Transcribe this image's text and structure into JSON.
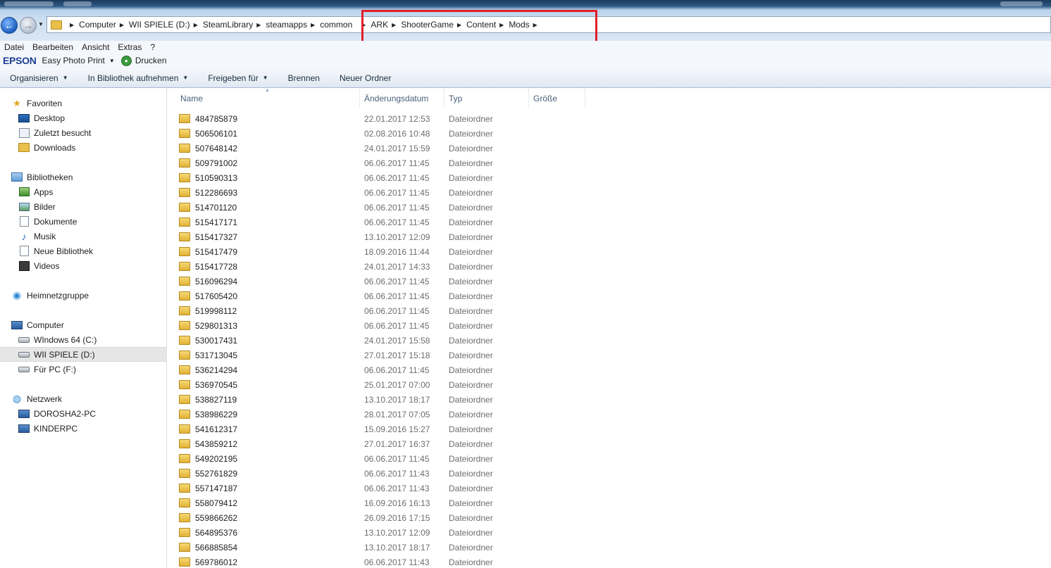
{
  "breadcrumbs": [
    "Computer",
    "WII SPIELE (D:)",
    "SteamLibrary",
    "steamapps",
    "common",
    "ARK",
    "ShooterGame",
    "Content",
    "Mods"
  ],
  "menu": [
    "Datei",
    "Bearbeiten",
    "Ansicht",
    "Extras",
    "?"
  ],
  "plugin": {
    "logo": "EPSON",
    "easy_photo": "Easy Photo Print",
    "print": "Drucken"
  },
  "toolbar": {
    "organize": "Organisieren",
    "add_library": "In Bibliothek aufnehmen",
    "share": "Freigeben für",
    "burn": "Brennen",
    "new_folder": "Neuer Ordner"
  },
  "nav": {
    "favorites": "Favoriten",
    "desktop": "Desktop",
    "recent": "Zuletzt besucht",
    "downloads": "Downloads",
    "libraries": "Bibliotheken",
    "apps": "Apps",
    "pictures": "Bilder",
    "documents": "Dokumente",
    "music": "Musik",
    "new_library": "Neue Bibliothek",
    "videos": "Videos",
    "homegroup": "Heimnetzgruppe",
    "computer": "Computer",
    "drive_c": "WIndows 64 (C:)",
    "drive_d": "WII SPIELE (D:)",
    "drive_f": "Für PC (F:)",
    "network": "Netzwerk",
    "net_pc1": "DOROSHA2-PC",
    "net_pc2": "KINDERPC"
  },
  "columns": {
    "name": "Name",
    "date": "Änderungsdatum",
    "type": "Typ",
    "size": "Größe"
  },
  "files": [
    {
      "name": "484785879",
      "date": "22.01.2017 12:53",
      "type": "Dateiordner"
    },
    {
      "name": "506506101",
      "date": "02.08.2016 10:48",
      "type": "Dateiordner"
    },
    {
      "name": "507648142",
      "date": "24.01.2017 15:59",
      "type": "Dateiordner"
    },
    {
      "name": "509791002",
      "date": "06.06.2017 11:45",
      "type": "Dateiordner"
    },
    {
      "name": "510590313",
      "date": "06.06.2017 11:45",
      "type": "Dateiordner"
    },
    {
      "name": "512286693",
      "date": "06.06.2017 11:45",
      "type": "Dateiordner"
    },
    {
      "name": "514701120",
      "date": "06.06.2017 11:45",
      "type": "Dateiordner"
    },
    {
      "name": "515417171",
      "date": "06.06.2017 11:45",
      "type": "Dateiordner"
    },
    {
      "name": "515417327",
      "date": "13.10.2017 12:09",
      "type": "Dateiordner"
    },
    {
      "name": "515417479",
      "date": "18.09.2016 11:44",
      "type": "Dateiordner"
    },
    {
      "name": "515417728",
      "date": "24.01.2017 14:33",
      "type": "Dateiordner"
    },
    {
      "name": "516096294",
      "date": "06.06.2017 11:45",
      "type": "Dateiordner"
    },
    {
      "name": "517605420",
      "date": "06.06.2017 11:45",
      "type": "Dateiordner"
    },
    {
      "name": "519998112",
      "date": "06.06.2017 11:45",
      "type": "Dateiordner"
    },
    {
      "name": "529801313",
      "date": "06.06.2017 11:45",
      "type": "Dateiordner"
    },
    {
      "name": "530017431",
      "date": "24.01.2017 15:58",
      "type": "Dateiordner"
    },
    {
      "name": "531713045",
      "date": "27.01.2017 15:18",
      "type": "Dateiordner"
    },
    {
      "name": "536214294",
      "date": "06.06.2017 11:45",
      "type": "Dateiordner"
    },
    {
      "name": "536970545",
      "date": "25.01.2017 07:00",
      "type": "Dateiordner"
    },
    {
      "name": "538827119",
      "date": "13.10.2017 18:17",
      "type": "Dateiordner"
    },
    {
      "name": "538986229",
      "date": "28.01.2017 07:05",
      "type": "Dateiordner"
    },
    {
      "name": "541612317",
      "date": "15.09.2016 15:27",
      "type": "Dateiordner"
    },
    {
      "name": "543859212",
      "date": "27.01.2017 16:37",
      "type": "Dateiordner"
    },
    {
      "name": "549202195",
      "date": "06.06.2017 11:45",
      "type": "Dateiordner"
    },
    {
      "name": "552761829",
      "date": "06.06.2017 11:43",
      "type": "Dateiordner"
    },
    {
      "name": "557147187",
      "date": "06.06.2017 11:43",
      "type": "Dateiordner"
    },
    {
      "name": "558079412",
      "date": "16.09.2016 16:13",
      "type": "Dateiordner"
    },
    {
      "name": "559866262",
      "date": "26.09.2016 17:15",
      "type": "Dateiordner"
    },
    {
      "name": "564895376",
      "date": "13.10.2017 12:09",
      "type": "Dateiordner"
    },
    {
      "name": "566885854",
      "date": "13.10.2017 18:17",
      "type": "Dateiordner"
    },
    {
      "name": "569786012",
      "date": "06.06.2017 11:43",
      "type": "Dateiordner"
    }
  ],
  "colors": {
    "highlight_box": "#e0202a",
    "selected_nav": "#e6e6e6"
  },
  "icons": {
    "back": "back-arrow-icon",
    "forward": "forward-arrow-icon",
    "folder": "folder-icon",
    "favorites": "star-icon",
    "print": "printer-icon"
  }
}
